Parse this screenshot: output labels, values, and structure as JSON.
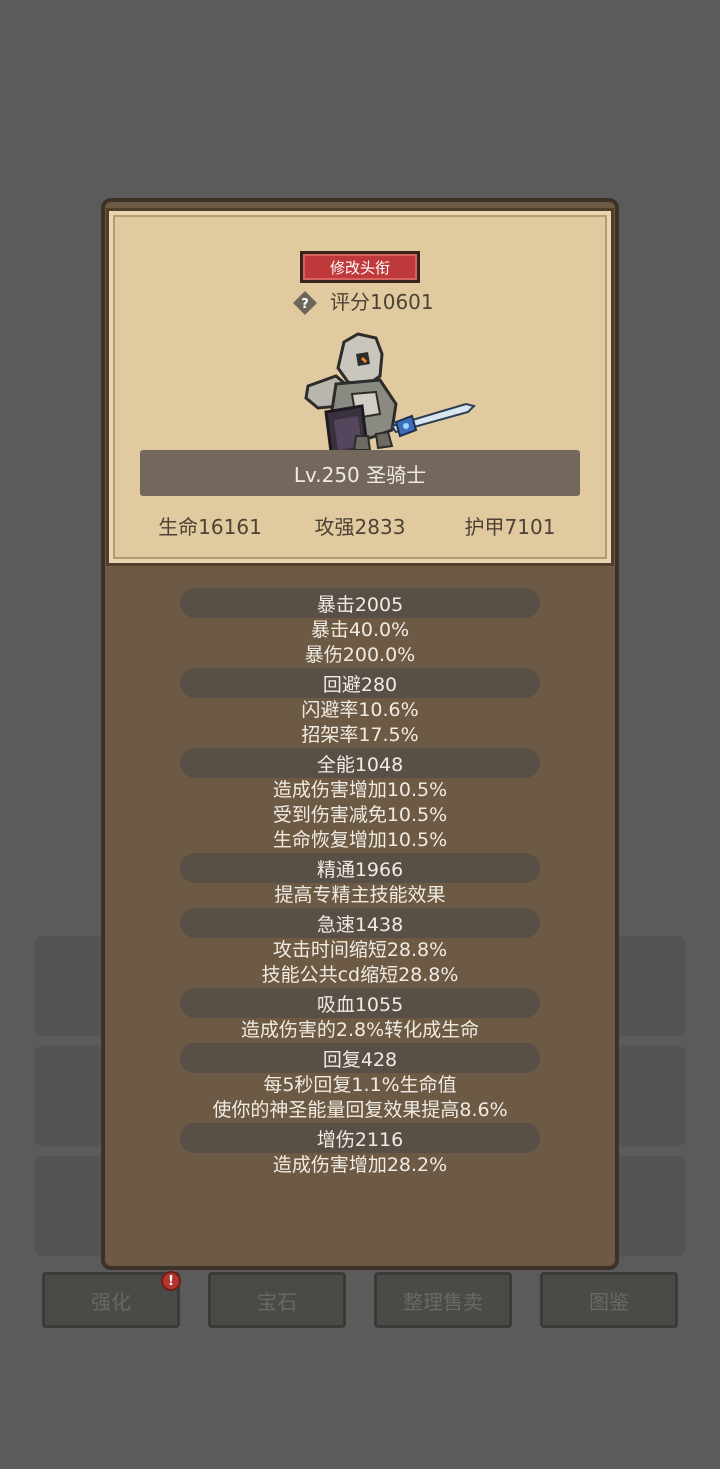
{
  "dialog": {
    "rename_button": "修改头衔",
    "score_label": "评分10601",
    "hero_name": "Lv.250 圣骑士",
    "top_stats": [
      "生命16161",
      "攻强2833",
      "护甲7101"
    ]
  },
  "attributes": [
    {
      "header": "暴击2005",
      "lines": [
        "暴击40.0%",
        "暴伤200.0%"
      ]
    },
    {
      "header": "回避280",
      "lines": [
        "闪避率10.6%",
        "招架率17.5%"
      ]
    },
    {
      "header": "全能1048",
      "lines": [
        "造成伤害增加10.5%",
        "受到伤害减免10.5%",
        "生命恢复增加10.5%"
      ]
    },
    {
      "header": "精通1966",
      "lines": [
        "提高专精主技能效果"
      ]
    },
    {
      "header": "急速1438",
      "lines": [
        "攻击时间缩短28.8%",
        "技能公共cd缩短28.8%"
      ]
    },
    {
      "header": "吸血1055",
      "lines": [
        "造成伤害的2.8%转化成生命"
      ]
    },
    {
      "header": "回复428",
      "lines": [
        "每5秒回复1.1%生命值",
        "使你的神圣能量回复效果提高8.6%"
      ]
    },
    {
      "header": "增伤2116",
      "lines": [
        "造成伤害增加28.2%"
      ]
    }
  ],
  "bottom_bar": {
    "buttons": [
      "强化",
      "宝石",
      "整理售卖",
      "图鉴"
    ],
    "badge": "!"
  },
  "colors": {
    "dialog_bg": "#6c5a45",
    "parchment": "#e2caa0",
    "rename_button": "#c0393a"
  }
}
